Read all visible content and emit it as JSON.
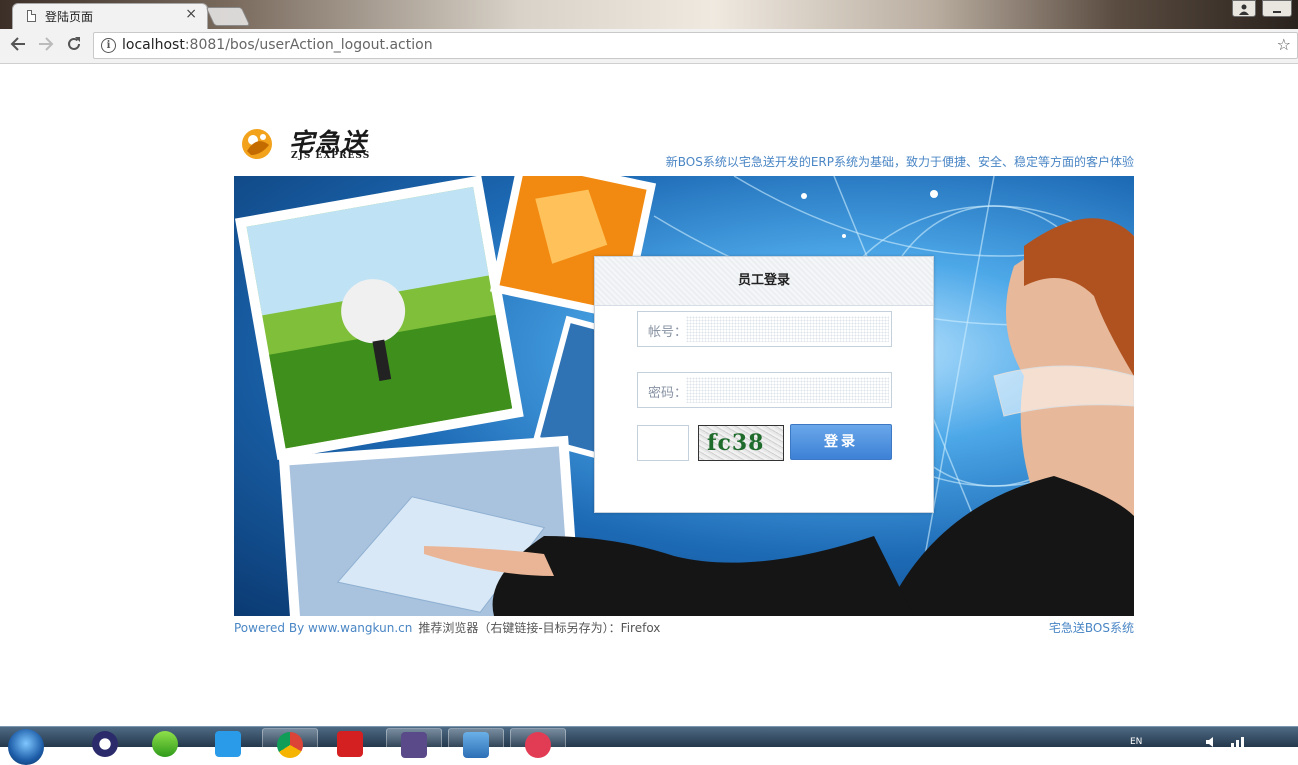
{
  "browser": {
    "tab_title": "登陆页面",
    "tab_close": "×",
    "url_host": "localhost",
    "url_rest": ":8081/bos/userAction_logout.action"
  },
  "header": {
    "logo_cn": "宅急送",
    "logo_en": "ZJS EXPRESS",
    "tagline": "新BOS系统以宅急送开发的ERP系统为基础，致力于便捷、安全、稳定等方面的客户体验"
  },
  "login": {
    "title": "员工登录",
    "username_label": "帐号：",
    "password_label": "密码：",
    "captcha_text": "fc38",
    "submit_label": "登录"
  },
  "footer": {
    "powered": "Powered By www.wangkun.cn",
    "hint": "推荐浏览器（右键链接-目标另存为）：Firefox",
    "right": "宅急送BOS系统"
  },
  "taskbar": {
    "lang": "EN"
  },
  "colors": {
    "link_blue": "#4a86c5",
    "button_blue": "#3d81d6"
  }
}
